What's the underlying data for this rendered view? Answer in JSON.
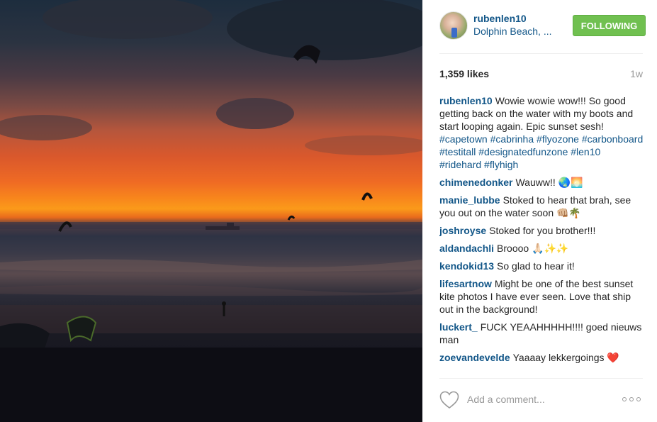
{
  "post": {
    "username": "rubenlen10",
    "location": "Dolphin Beach, ...",
    "follow_label": "FOLLOWING",
    "likes": "1,359 likes",
    "ago": "1w"
  },
  "caption": {
    "author": "rubenlen10",
    "text": "Wowie wowie wow!!! So good getting back on the water with my boots and start looping again. Epic sunset sesh!",
    "tags": [
      "#capetown",
      "#cabrinha",
      "#flyozone",
      "#carbonboard",
      "#testitall",
      "#designatedfunzone",
      "#len10",
      "#ridehard",
      "#flyhigh"
    ]
  },
  "comments": [
    {
      "author": "chimenedonker",
      "text": "Wauww!! 🌏🌅"
    },
    {
      "author": "manie_lubbe",
      "text": "Stoked to hear that brah, see you out on the water soon 👊🏼🌴"
    },
    {
      "author": "joshroyse",
      "text": "Stoked for you brother!!!"
    },
    {
      "author": "aldandachli",
      "text": "Broooo 🙏🏻✨✨"
    },
    {
      "author": "kendokid13",
      "text": "So glad to hear it!"
    },
    {
      "author": "lifesartnow",
      "text": "Might be one of the best sunset kite photos I have ever seen. Love that ship out in the background!"
    },
    {
      "author": "luckert_",
      "text": "FUCK YEAAHHHHH!!!! goed nieuws man"
    },
    {
      "author": "zoevandevelde",
      "text": "Yaaaay lekkergoings ❤️"
    }
  ],
  "footer": {
    "add_comment_placeholder": "Add a comment..."
  },
  "colors": {
    "link": "#125688",
    "follow_button": "#70c050",
    "muted": "#999999"
  },
  "icons": [
    "heart-icon",
    "more-options-icon"
  ]
}
